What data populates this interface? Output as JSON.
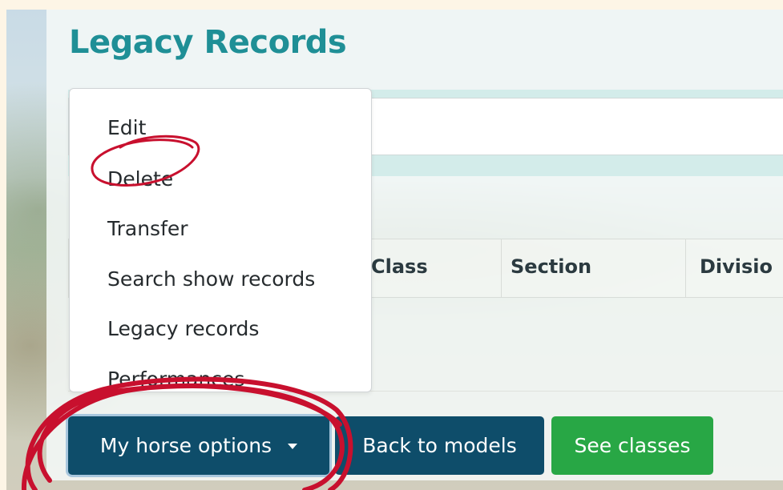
{
  "page": {
    "title": "Legacy Records"
  },
  "table": {
    "headers": [
      "Class",
      "Section",
      "Divisio"
    ]
  },
  "dropdown": {
    "items": [
      {
        "label": "Edit"
      },
      {
        "label": "Delete"
      },
      {
        "label": "Transfer"
      },
      {
        "label": "Search show records"
      },
      {
        "label": "Legacy records"
      },
      {
        "label": "Performances"
      }
    ]
  },
  "buttons": {
    "horse_options": "My horse options",
    "back_to_models": "Back to models",
    "see_classes": "See classes"
  },
  "colors": {
    "title": "#1f8f96",
    "primary_button": "#0e4d6a",
    "success_button": "#28a745",
    "annotation": "#c8102e"
  },
  "icons": {
    "dropdown_caret": "caret-down-icon"
  }
}
